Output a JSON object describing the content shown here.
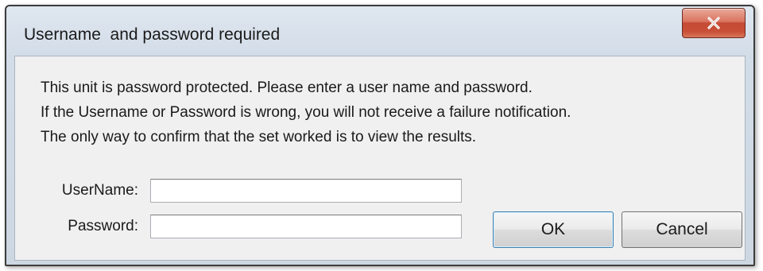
{
  "dialog": {
    "title": "Username  and password required",
    "close_icon": "close-x-icon",
    "message_lines": [
      "This unit is password protected. Please enter a user name and password.",
      "If the Username or Password is wrong, you will not receive a failure notification.",
      "The only way to confirm that the set worked is to view the results."
    ],
    "username_label": "UserName:",
    "username_value": "",
    "password_label": "Password:",
    "password_value": "",
    "ok_label": "OK",
    "cancel_label": "Cancel"
  },
  "colors": {
    "close_button": "#c94f37",
    "frame": "#d3dde8",
    "client": "#f0f0f0",
    "default_button_border": "#3c7fb1"
  }
}
